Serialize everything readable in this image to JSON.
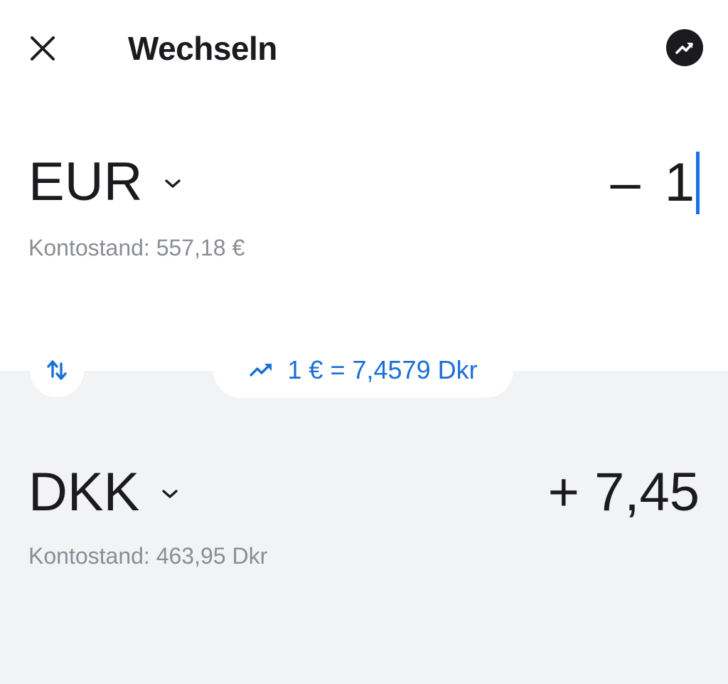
{
  "header": {
    "title": "Wechseln",
    "close_icon": "close-icon",
    "chart_icon": "trending-up-icon"
  },
  "from": {
    "currency": "EUR",
    "amount_sign": "–",
    "amount_value": "1",
    "balance": "Kontostand: 557,18 €"
  },
  "to": {
    "currency": "DKK",
    "amount": "+ 7,45",
    "balance": "Kontostand: 463,95 Dkr"
  },
  "rate": {
    "text": "1 € = 7,4579 Dkr",
    "icon": "trending-up-icon"
  },
  "swap": {
    "icon": "swap-vertical-icon"
  },
  "colors": {
    "accent": "#1A6FD8",
    "caret": "#1672E6",
    "text": "#1B1B1F",
    "muted": "#8A8D93",
    "lower_background": "#F2F3F5"
  }
}
